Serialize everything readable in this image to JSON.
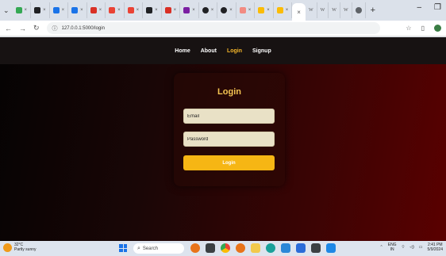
{
  "browser": {
    "url": "127.0.0.1:5000/login",
    "new_tab_label": "+",
    "tabs": [
      {
        "name": "dropdown",
        "color": "#5f6368"
      },
      {
        "name": "tab-1",
        "color": "#34a853"
      },
      {
        "name": "tab-2",
        "color": "#202124"
      },
      {
        "name": "tab-3",
        "color": "#1a73e8"
      },
      {
        "name": "tab-4",
        "color": "#1a73e8"
      },
      {
        "name": "tab-5",
        "color": "#d93025"
      },
      {
        "name": "tab-6",
        "color": "#ea4335"
      },
      {
        "name": "tab-7",
        "color": "#ea4335"
      },
      {
        "name": "tab-8",
        "color": "#202124"
      },
      {
        "name": "tab-9",
        "color": "#d93025"
      },
      {
        "name": "tab-10",
        "color": "#7b1fa2"
      },
      {
        "name": "tab-11",
        "color": "#202124"
      },
      {
        "name": "tab-12",
        "color": "#202124"
      },
      {
        "name": "tab-13",
        "color": "#f28b82"
      },
      {
        "name": "tab-14",
        "color": "#fbbc04"
      },
      {
        "name": "tab-15",
        "color": "#fbbc04"
      }
    ]
  },
  "navbar": {
    "links": [
      "Home",
      "About",
      "Login",
      "Signup"
    ]
  },
  "login": {
    "title": "Login",
    "email_placeholder": "Email",
    "password_placeholder": "Password",
    "submit_label": "Login"
  },
  "taskbar": {
    "temperature": "32°C",
    "weather": "Partly sunny",
    "search_placeholder": "Search",
    "lang_top": "ENG",
    "lang_bottom": "IN",
    "time": "2:41 PM",
    "date": "5/9/2024"
  },
  "colors": {
    "accent": "#f6b614",
    "title": "#f5c452",
    "nav_active": "#f5b62a",
    "field_bg": "#e9e1c6"
  }
}
